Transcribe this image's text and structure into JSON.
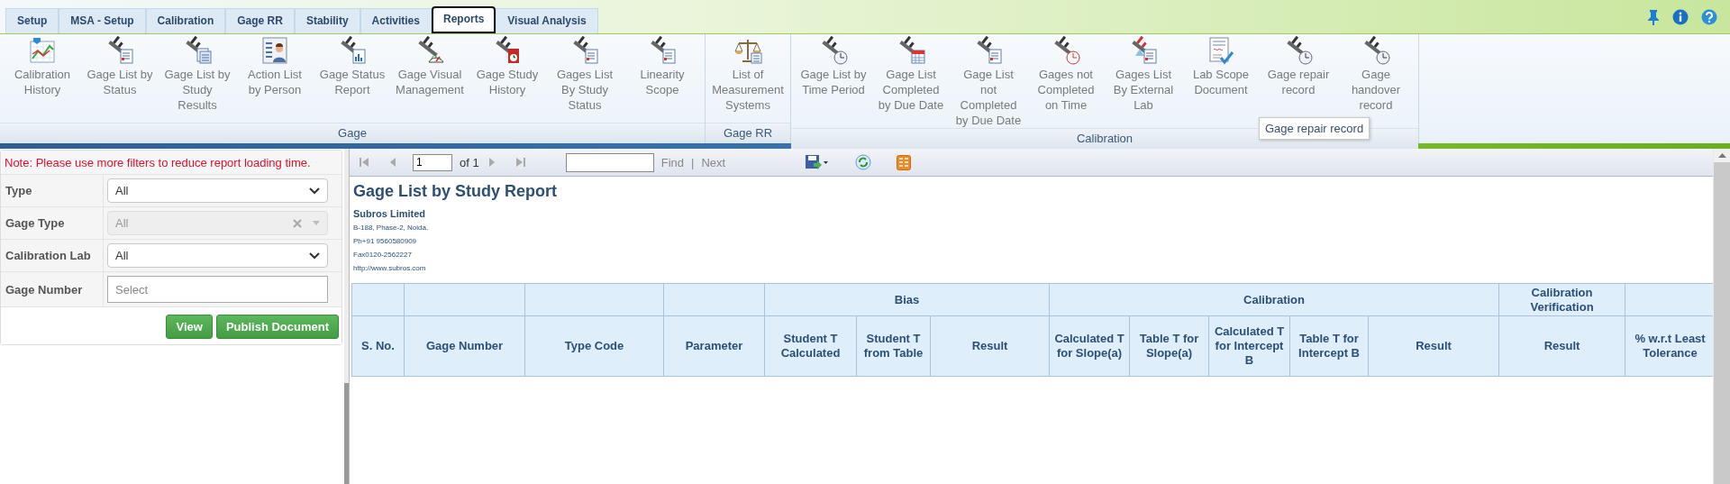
{
  "tabs": [
    {
      "label": "Setup",
      "selected": false
    },
    {
      "label": "MSA - Setup",
      "selected": false
    },
    {
      "label": "Calibration",
      "selected": false
    },
    {
      "label": "Gage RR",
      "selected": false
    },
    {
      "label": "Stability",
      "selected": false
    },
    {
      "label": "Activities",
      "selected": false
    },
    {
      "label": "Reports",
      "selected": true
    },
    {
      "label": "Visual Analysis",
      "selected": false
    }
  ],
  "ribbon": {
    "groups": [
      {
        "label": "Gage",
        "items": [
          "Calibration History",
          "Gage List by Status",
          "Gage List by Study Results",
          "Action List by Person",
          "Gage Status Report",
          "Gage Visual Management",
          "Gage Study History",
          "Gages List By Study Status",
          "Linearity Scope"
        ]
      },
      {
        "label": "Gage RR",
        "items": [
          "List of Measurement Systems"
        ]
      },
      {
        "label": "Calibration",
        "items": [
          "Gage List by Time Period",
          "Gage List Completed by Due Date",
          "Gage List not Completed by Due Date",
          "Gages not Completed on Time",
          "Gages List By External Lab",
          "Lab Scope Document",
          "Gage repair record",
          "Gage handover record"
        ]
      }
    ],
    "tooltip": "Gage repair record"
  },
  "filters": {
    "note": "Note: Please use more filters to reduce report loading time.",
    "fields": [
      {
        "label": "Type",
        "kind": "select",
        "value": "All",
        "disabled": false
      },
      {
        "label": "Gage Type",
        "kind": "combo",
        "value": "All",
        "disabled": true
      },
      {
        "label": "Calibration Lab",
        "kind": "select",
        "value": "All",
        "disabled": false
      },
      {
        "label": "Gage Number",
        "kind": "text",
        "placeholder": "Select"
      }
    ],
    "buttons": [
      "View",
      "Publish Document"
    ]
  },
  "report_toolbar": {
    "page": "1",
    "page_count": "of 1",
    "find": "Find",
    "separator": "|",
    "next": "Next"
  },
  "report": {
    "title": "Gage List by Study Report",
    "company": "Subros Limited",
    "address_lines": [
      "B-188, Phase-2, Noida.",
      "Ph+91 9560580909",
      "Fax0120-2562227",
      "http://www.subros.com"
    ],
    "table": {
      "groups": [
        {
          "columns": [
            "S. No."
          ]
        },
        {
          "columns": [
            "Gage Number"
          ]
        },
        {
          "columns": [
            "Type Code"
          ]
        },
        {
          "columns": [
            "Parameter"
          ]
        },
        {
          "label": "Bias",
          "columns": [
            "Student T Calculated",
            "Student T from Table",
            "Result"
          ]
        },
        {
          "label": "Calibration",
          "columns": [
            "Calculated T for Slope(a)",
            "Table T for Slope(a)",
            "Calculated T for Intercept B",
            "Table T for Intercept B",
            "Result"
          ]
        },
        {
          "label": "Calibration Verification",
          "columns": [
            "Result"
          ]
        },
        {
          "columns": [
            "% w.r.t Least Tolerance"
          ]
        }
      ]
    }
  }
}
